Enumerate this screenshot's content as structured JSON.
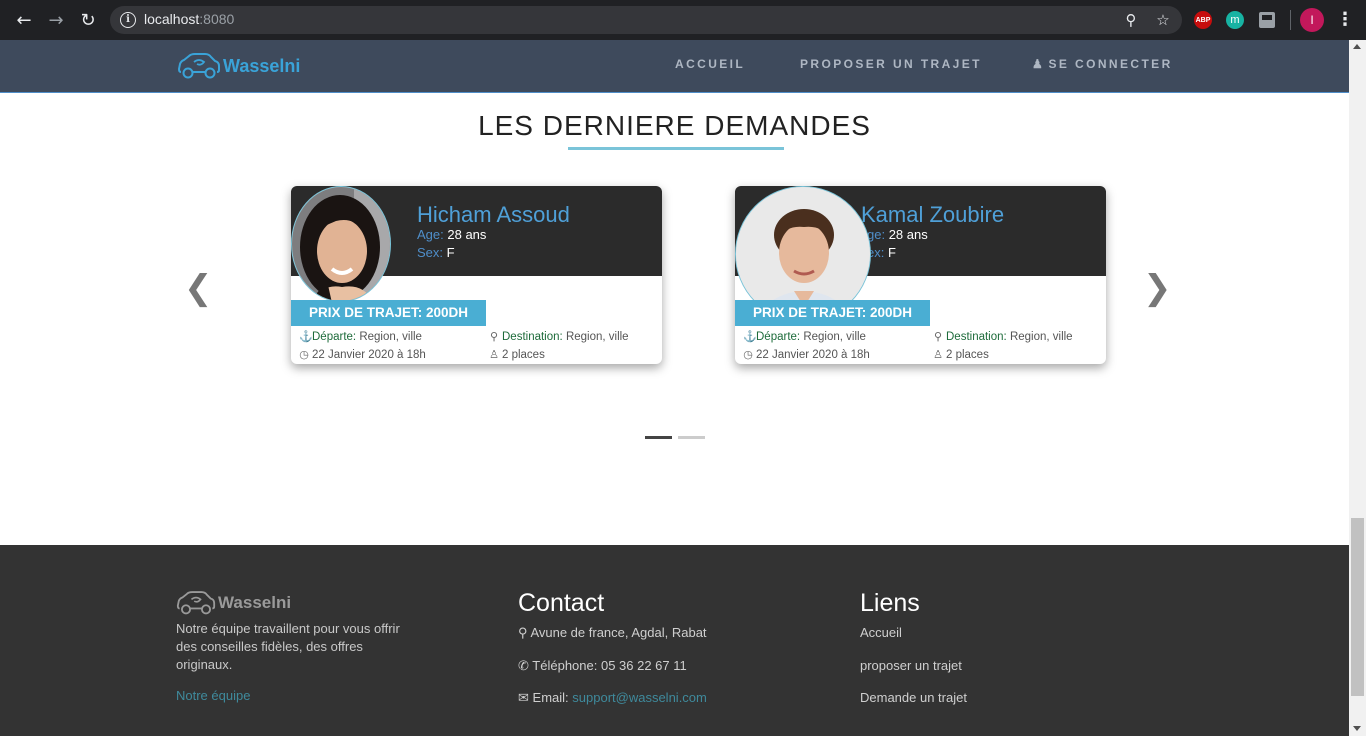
{
  "browser": {
    "url_host": "localhost",
    "url_port": ":8080",
    "profile_initial": "I",
    "ext_abp": "ABP",
    "ext_m": "m"
  },
  "nav": {
    "brand": "Wasselni",
    "links": [
      "ACCUEIL",
      "PROPOSER UN TRAJET",
      "SE CONNECTER"
    ]
  },
  "section": {
    "title": "LES DERNIERE DEMANDES"
  },
  "cards": [
    {
      "name": "Hicham Assoud",
      "age_label": "Age:",
      "age": "28 ans",
      "sex_label": "Sex:",
      "sex": "F",
      "price": "PRIX DE TRAJET: 200DH",
      "depart_label": "Départe:",
      "depart": "Region, ville",
      "dest_label": "Destination:",
      "dest": "Region, ville",
      "date": "22 Janvier 2020 à 18h",
      "places": "2 places"
    },
    {
      "name": "Kamal Zoubire",
      "age_label": "ge:",
      "age": "28 ans",
      "sex_label": "ex:",
      "sex": "F",
      "price": "PRIX DE TRAJET: 200DH",
      "depart_label": "Départe:",
      "depart": "Region, ville",
      "dest_label": "Destination:",
      "dest": "Region, ville",
      "date": "22 Janvier 2020 à 18h",
      "places": "2 places"
    }
  ],
  "carousel": {
    "dot_count": 2,
    "active_index": 0
  },
  "footer": {
    "brand": "Wasselni",
    "about": "Notre équipe travaillent pour vous offrir des conseilles fidèles, des offres originaux.",
    "team_link": "Notre équipe",
    "contact_title": "Contact",
    "address": "Avune de france, Agdal, Rabat",
    "phone": "Téléphone: 05 36 22 67 11",
    "email_label": "Email:",
    "email": "support@wasselni.com",
    "links_title": "Liens",
    "links": [
      "Accueil",
      "proposer un trajet",
      "Demande un trajet"
    ]
  },
  "colors": {
    "nav_bg": "#3e4a5c",
    "brand_blue": "#3aa3d8",
    "price_badge": "#4aaed3",
    "footer_bg": "#333333"
  }
}
